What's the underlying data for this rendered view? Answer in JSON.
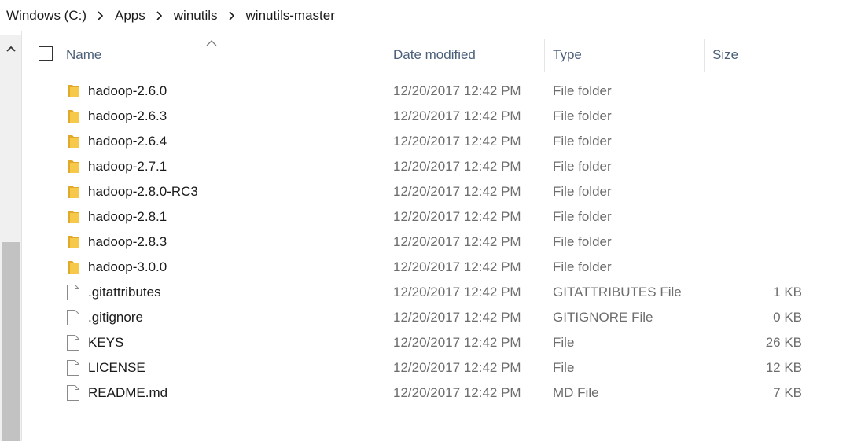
{
  "breadcrumb": [
    "Windows (C:)",
    "Apps",
    "winutils",
    "winutils-master"
  ],
  "columns": {
    "name": "Name",
    "date": "Date modified",
    "type": "Type",
    "size": "Size"
  },
  "sort": {
    "column": "name",
    "direction": "ascending"
  },
  "colors": {
    "folder": "#f6c94a",
    "folder_dark": "#e0a92a",
    "header_text": "#4c607a",
    "secondary_text": "#6d6d6d",
    "scroll_thumb": "#c2c2c2"
  },
  "files": [
    {
      "name": "hadoop-2.6.0",
      "date": "12/20/2017 12:42 PM",
      "type": "File folder",
      "size": "",
      "icon": "folder-icon"
    },
    {
      "name": "hadoop-2.6.3",
      "date": "12/20/2017 12:42 PM",
      "type": "File folder",
      "size": "",
      "icon": "folder-icon"
    },
    {
      "name": "hadoop-2.6.4",
      "date": "12/20/2017 12:42 PM",
      "type": "File folder",
      "size": "",
      "icon": "folder-icon"
    },
    {
      "name": "hadoop-2.7.1",
      "date": "12/20/2017 12:42 PM",
      "type": "File folder",
      "size": "",
      "icon": "folder-icon"
    },
    {
      "name": "hadoop-2.8.0-RC3",
      "date": "12/20/2017 12:42 PM",
      "type": "File folder",
      "size": "",
      "icon": "folder-icon"
    },
    {
      "name": "hadoop-2.8.1",
      "date": "12/20/2017 12:42 PM",
      "type": "File folder",
      "size": "",
      "icon": "folder-icon"
    },
    {
      "name": "hadoop-2.8.3",
      "date": "12/20/2017 12:42 PM",
      "type": "File folder",
      "size": "",
      "icon": "folder-icon"
    },
    {
      "name": "hadoop-3.0.0",
      "date": "12/20/2017 12:42 PM",
      "type": "File folder",
      "size": "",
      "icon": "folder-icon"
    },
    {
      "name": ".gitattributes",
      "date": "12/20/2017 12:42 PM",
      "type": "GITATTRIBUTES File",
      "size": "1 KB",
      "icon": "file-icon"
    },
    {
      "name": ".gitignore",
      "date": "12/20/2017 12:42 PM",
      "type": "GITIGNORE File",
      "size": "0 KB",
      "icon": "file-icon"
    },
    {
      "name": "KEYS",
      "date": "12/20/2017 12:42 PM",
      "type": "File",
      "size": "26 KB",
      "icon": "file-icon"
    },
    {
      "name": "LICENSE",
      "date": "12/20/2017 12:42 PM",
      "type": "File",
      "size": "12 KB",
      "icon": "file-icon"
    },
    {
      "name": "README.md",
      "date": "12/20/2017 12:42 PM",
      "type": "MD File",
      "size": "7 KB",
      "icon": "file-icon"
    }
  ]
}
